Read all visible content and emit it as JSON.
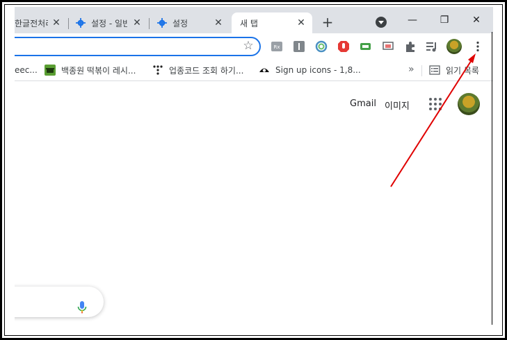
{
  "tabs": [
    {
      "title": "한글전처리",
      "close": "✕"
    },
    {
      "title": "설정 - 일반",
      "close": "✕"
    },
    {
      "title": "설정",
      "close": "✕"
    },
    {
      "title": "새 탭",
      "close": "✕"
    }
  ],
  "new_tab_label": "+",
  "window_controls": {
    "minimize": "—",
    "restore": "❐",
    "close": "✕"
  },
  "bookmarks": [
    {
      "label": "eec...",
      "icon": "page-icon"
    },
    {
      "label": "백종원 떡볶이 레시...",
      "icon": "pot-icon"
    },
    {
      "label": "업종코드 조회 하기...",
      "icon": "tistory-icon"
    },
    {
      "label": "Sign up icons - 1,8...",
      "icon": "eye-icon"
    }
  ],
  "bookmarks_more": "»",
  "reading_list": "읽기 목록",
  "header_links": {
    "gmail": "Gmail",
    "images": "이미지"
  },
  "extensions": [
    "rx-icon",
    "instapaper-icon",
    "circle-icon",
    "adblock-icon",
    "tag-icon",
    "screen-icon",
    "puzzle-icon",
    "media-icon"
  ],
  "colors": {
    "accent": "#1a73e8",
    "arrow": "#e00000"
  }
}
